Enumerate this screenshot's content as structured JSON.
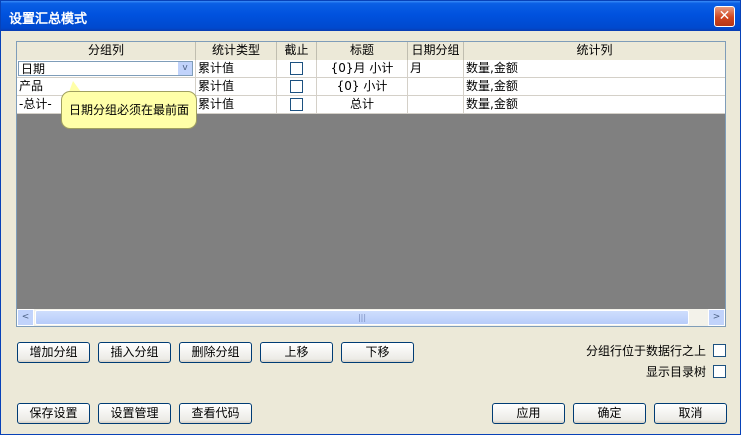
{
  "window": {
    "title": "设置汇总模式",
    "close_label": "✕"
  },
  "grid": {
    "columns": [
      "分组列",
      "统计类型",
      "截止",
      "标题",
      "日期分组",
      "统计列"
    ],
    "rows": [
      {
        "group": "日期",
        "stat_type": "累计值",
        "title": "{0}月 小计",
        "date_group": "月",
        "stat_cols": "数量,金额"
      },
      {
        "group": "产品",
        "stat_type": "累计值",
        "title": "{0} 小计",
        "date_group": "",
        "stat_cols": "数量,金额"
      },
      {
        "group": "-总计-",
        "stat_type": "累计值",
        "title": "总计",
        "date_group": "",
        "stat_cols": "数量,金额"
      }
    ],
    "tooltip": "日期分组必须在最前面",
    "scroll_left": "<",
    "scroll_right": ">",
    "scroll_thumb": "|||",
    "combo_arrow": "v"
  },
  "actions": {
    "add_group": "增加分组",
    "insert_group": "插入分组",
    "delete_group": "删除分组",
    "move_up": "上移",
    "move_down": "下移"
  },
  "options": {
    "group_row_above": "分组行位于数据行之上",
    "show_tree": "显示目录树"
  },
  "footer": {
    "save_settings": "保存设置",
    "manage_settings": "设置管理",
    "view_code": "查看代码",
    "apply": "应用",
    "ok": "确定",
    "cancel": "取消"
  }
}
